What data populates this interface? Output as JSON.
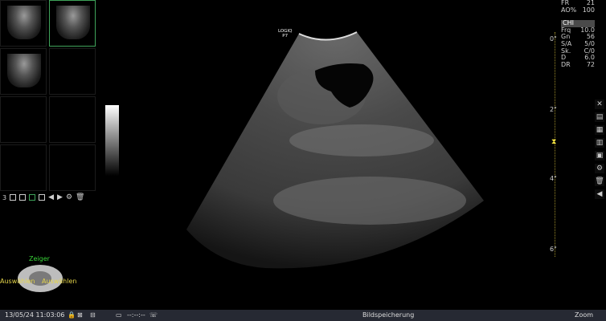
{
  "probe": {
    "brand": "LOGIQ",
    "model": "P7"
  },
  "thumbnails": {
    "page_count": "3"
  },
  "trackball": {
    "top_label": "Zeiger",
    "left_label": "Auswählen",
    "right_label": "Auswählen"
  },
  "params": [
    {
      "k": "FR",
      "v": "21"
    },
    {
      "k": "AO%",
      "v": "100"
    },
    {
      "k": "CHI",
      "v": ""
    },
    {
      "k": "Frq",
      "v": "10.0"
    },
    {
      "k": "Gn",
      "v": "56"
    },
    {
      "k": "S/A",
      "v": "5/0"
    },
    {
      "k": "Sk.",
      "v": "C/0"
    },
    {
      "k": "D",
      "v": "6.0"
    },
    {
      "k": "DR",
      "v": "72"
    }
  ],
  "depth_marks": [
    "0\"",
    "2\"",
    "4\"",
    "6\""
  ],
  "status": {
    "datetime": "13/05/24 11:03:06",
    "timer": "--:--:--",
    "center": "Bildspeicherung",
    "zoom": "Zoom"
  },
  "colors": {
    "accent_green": "#3fa35a",
    "trackball_yellow": "#e6d64a",
    "statusbar": "#262933"
  }
}
